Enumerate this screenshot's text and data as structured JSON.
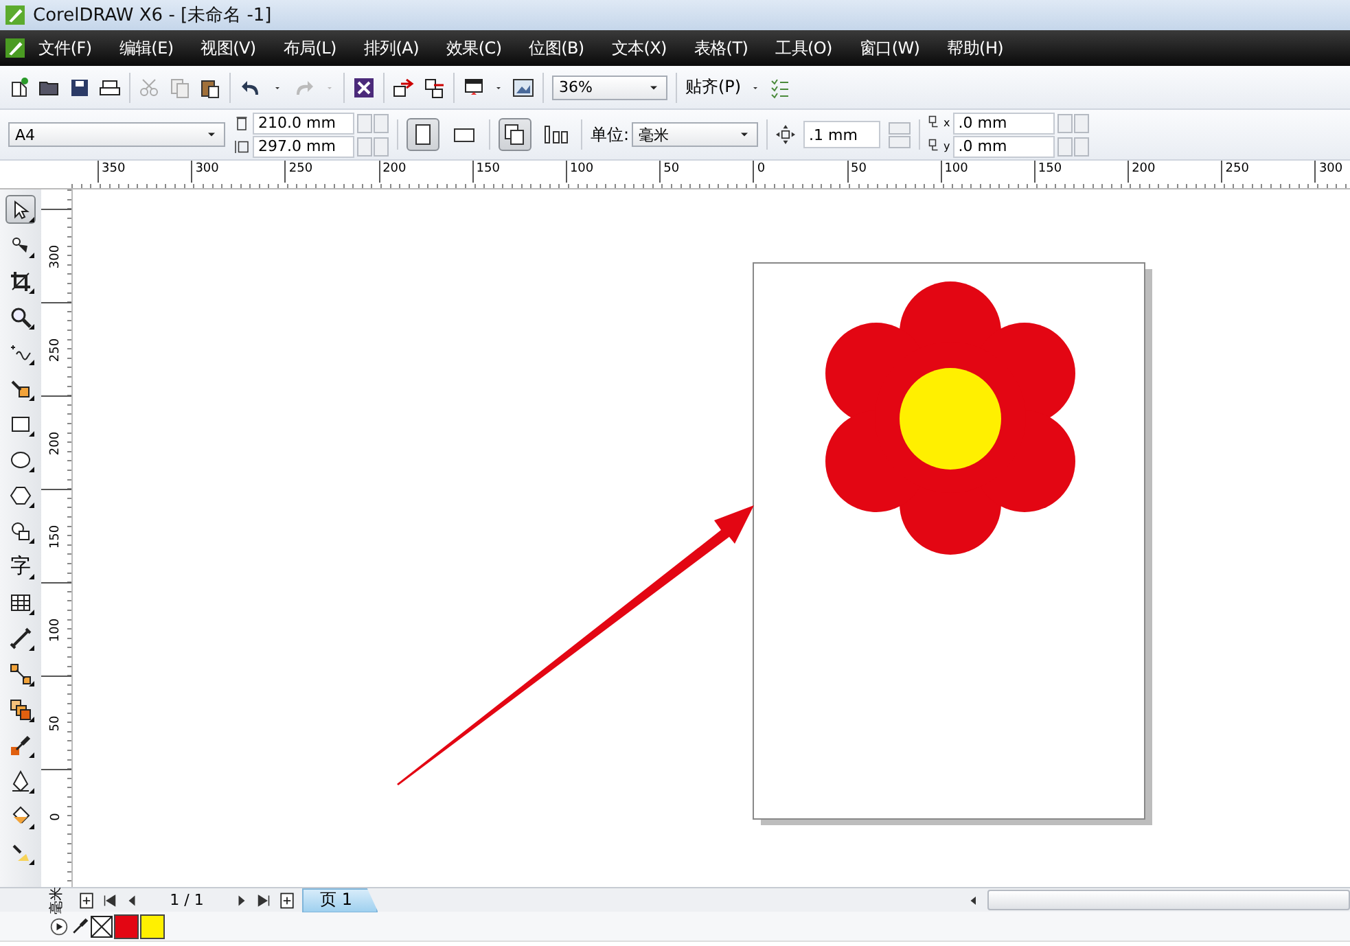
{
  "window": {
    "title": "CorelDRAW X6 - [未命名 -1]"
  },
  "menu": [
    "文件(F)",
    "编辑(E)",
    "视图(V)",
    "布局(L)",
    "排列(A)",
    "效果(C)",
    "位图(B)",
    "文本(X)",
    "表格(T)",
    "工具(O)",
    "窗口(W)",
    "帮助(H)"
  ],
  "standard_toolbar": {
    "zoom": "36%",
    "snap": "贴齐(P)"
  },
  "property_bar": {
    "page_size": "A4",
    "width": "210.0 mm",
    "height": "297.0 mm",
    "portrait": true,
    "all_pages": true,
    "unit_label": "单位:",
    "unit": "毫米",
    "nudge": ".1 mm",
    "duplicate_x_axis": "x",
    "duplicate_x": ".0 mm",
    "duplicate_y_axis": "y",
    "duplicate_y": ".0 mm"
  },
  "horizontal_ruler": [
    "350",
    "300",
    "250",
    "200",
    "150",
    "100",
    "50",
    "0",
    "50",
    "100",
    "150",
    "200",
    "250",
    "300"
  ],
  "vertical_ruler": [
    "300",
    "250",
    "200",
    "150",
    "100",
    "50",
    "0"
  ],
  "ruler_unit": "毫米",
  "toolbox": [
    {
      "kind": "pick",
      "selected": true
    },
    {
      "kind": "shape",
      "selected": false
    },
    {
      "kind": "crop",
      "selected": false
    },
    {
      "kind": "zoom",
      "selected": false
    },
    {
      "kind": "curve",
      "selected": false
    },
    {
      "kind": "smart",
      "selected": false
    },
    {
      "kind": "rect",
      "selected": false
    },
    {
      "kind": "ellipse",
      "selected": false
    },
    {
      "kind": "polygon",
      "selected": false
    },
    {
      "kind": "basic",
      "selected": false
    },
    {
      "kind": "text",
      "label": "字",
      "selected": false
    },
    {
      "kind": "table",
      "selected": false
    },
    {
      "kind": "dimension",
      "selected": false
    },
    {
      "kind": "connector",
      "selected": false
    },
    {
      "kind": "blend",
      "selected": false
    },
    {
      "kind": "eyedropper",
      "selected": false
    },
    {
      "kind": "outline",
      "selected": false
    },
    {
      "kind": "fill",
      "selected": false
    },
    {
      "kind": "interactive",
      "selected": false
    }
  ],
  "page_nav": {
    "counter": "1 / 1",
    "tabs": [
      {
        "label": "页 1",
        "selected": true
      }
    ]
  },
  "palette": [
    {
      "color": "#e30613"
    },
    {
      "color": "#fff000"
    }
  ]
}
